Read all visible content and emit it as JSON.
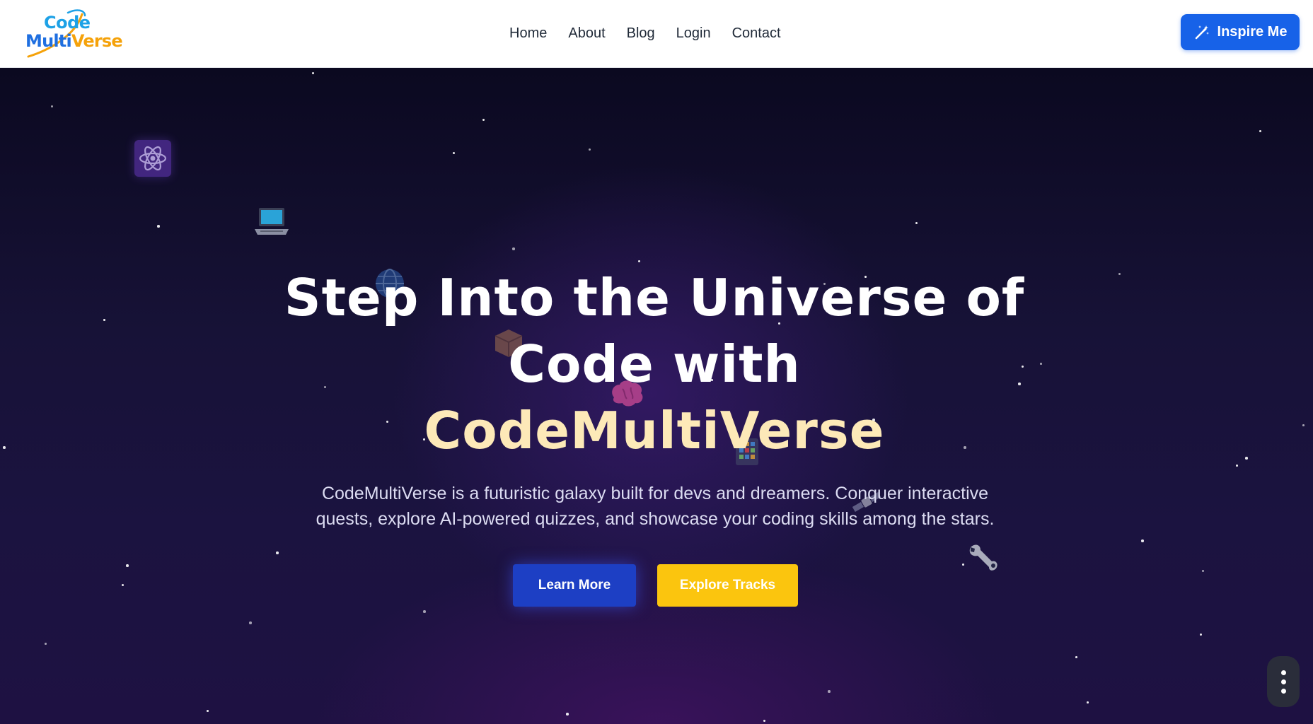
{
  "header": {
    "logo": {
      "line1": "Code",
      "line2_a": "Multi",
      "line2_b": "Verse"
    },
    "nav": [
      "Home",
      "About",
      "Blog",
      "Login",
      "Contact"
    ],
    "inspire_label": "Inspire Me"
  },
  "hero": {
    "title_line1": "Step Into the Universe of",
    "title_line2": "Code with",
    "title_accent": "CodeMultiVerse",
    "subtitle": "CodeMultiVerse is a futuristic galaxy built for devs and dreamers. Conquer interactive quests, explore AI-powered quizzes, and showcase your coding skills among the stars.",
    "learn_more_label": "Learn More",
    "explore_tracks_label": "Explore Tracks"
  },
  "icons": [
    "atom-icon",
    "laptop-icon",
    "globe-icon",
    "package-icon",
    "brain-icon",
    "abacus-icon",
    "satellite-icon",
    "wrench-icon",
    "kebab-menu-icon",
    "magic-wand-icon"
  ],
  "colors": {
    "accent": "#1762e8",
    "learn_more": "#1d3fc4",
    "explore": "#fbc50e",
    "title_accent": "#fde9b8"
  }
}
